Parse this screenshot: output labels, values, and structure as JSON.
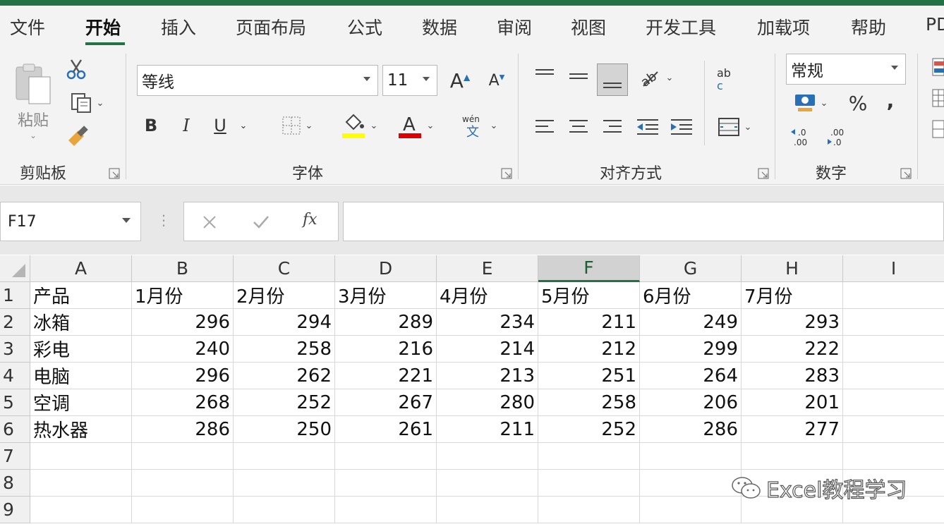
{
  "ribbon_tabs": [
    "文件",
    "开始",
    "插入",
    "页面布局",
    "公式",
    "数据",
    "审阅",
    "视图",
    "开发工具",
    "加载项",
    "帮助",
    "PD"
  ],
  "active_tab": "开始",
  "clipboard": {
    "paste_label": "粘贴",
    "group_label": "剪贴板"
  },
  "font": {
    "name": "等线",
    "size": "11",
    "group_label": "字体",
    "bold": "B",
    "italic": "I",
    "underline": "U",
    "font_color": "#e00000",
    "fill_color": "#ffff00"
  },
  "alignment": {
    "group_label": "对齐方式"
  },
  "number": {
    "format": "常规",
    "group_label": "数字",
    "percent": "%",
    "comma": ","
  },
  "formula_bar": {
    "name_box": "F17",
    "fx": "fx",
    "formula": ""
  },
  "grid": {
    "columns": [
      "A",
      "B",
      "C",
      "D",
      "E",
      "F",
      "G",
      "H",
      "I"
    ],
    "selected_column": "F",
    "rows": [
      [
        "产品",
        "1月份",
        "2月份",
        "3月份",
        "4月份",
        "5月份",
        "6月份",
        "7月份"
      ],
      [
        "冰箱",
        "296",
        "294",
        "289",
        "234",
        "211",
        "249",
        "293"
      ],
      [
        "彩电",
        "240",
        "258",
        "216",
        "214",
        "212",
        "299",
        "222"
      ],
      [
        "电脑",
        "296",
        "262",
        "221",
        "213",
        "251",
        "264",
        "283"
      ],
      [
        "空调",
        "268",
        "252",
        "267",
        "280",
        "258",
        "206",
        "201"
      ],
      [
        "热水器",
        "286",
        "250",
        "261",
        "211",
        "252",
        "286",
        "277"
      ],
      [
        "",
        "",
        "",
        "",
        "",
        "",
        "",
        ""
      ],
      [
        "",
        "",
        "",
        "",
        "",
        "",
        "",
        ""
      ],
      [
        "",
        "",
        "",
        "",
        "",
        "",
        "",
        ""
      ]
    ],
    "row_numbers": [
      "1",
      "2",
      "3",
      "4",
      "5",
      "6",
      "7",
      "8",
      "9"
    ]
  },
  "watermark": "Excel教程学习",
  "accent": "#217346"
}
